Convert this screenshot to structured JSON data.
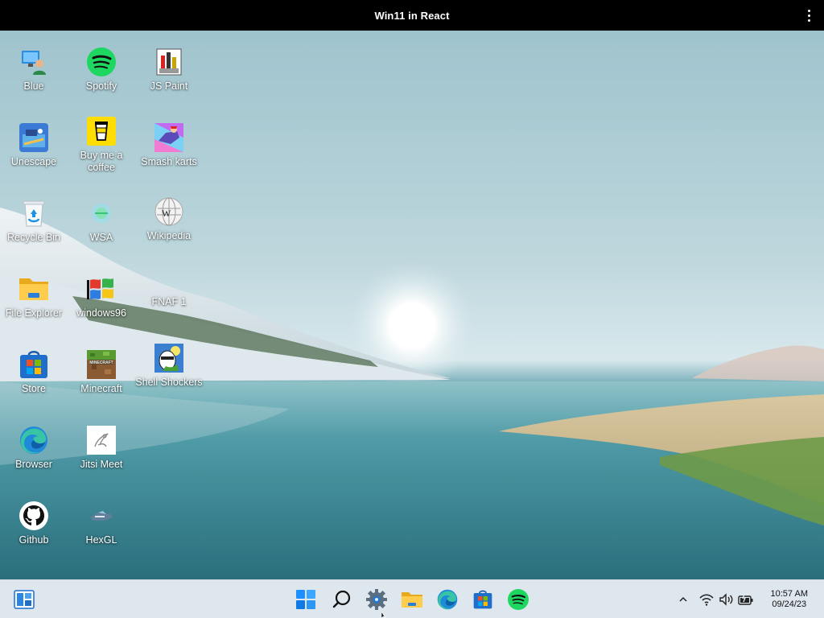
{
  "window": {
    "title": "Win11 in React"
  },
  "desktop_icons": [
    {
      "label": "Blue",
      "icon": "blue-user-icon"
    },
    {
      "label": "Spotify",
      "icon": "spotify-icon"
    },
    {
      "label": "JS Paint",
      "icon": "paint-icon"
    },
    {
      "label": "Unescape",
      "icon": "unescape-icon"
    },
    {
      "label": "Buy me a coffee",
      "icon": "coffee-cup-icon"
    },
    {
      "label": "Smash karts",
      "icon": "smash-karts-icon"
    },
    {
      "label": "Recycle Bin",
      "icon": "recycle-bin-icon"
    },
    {
      "label": "WSA",
      "icon": "wsa-icon"
    },
    {
      "label": "Wikipedia",
      "icon": "wikipedia-icon"
    },
    {
      "label": "File Explorer",
      "icon": "folder-icon"
    },
    {
      "label": "windows96",
      "icon": "windows96-icon"
    },
    {
      "label": "FNAF 1",
      "icon": "fnaf-icon"
    },
    {
      "label": "Store",
      "icon": "store-icon"
    },
    {
      "label": "Minecraft",
      "icon": "minecraft-icon"
    },
    {
      "label": "Shell Shockers",
      "icon": "shell-shockers-icon"
    },
    {
      "label": "Browser",
      "icon": "edge-icon"
    },
    {
      "label": "Jitsi Meet",
      "icon": "jitsi-icon"
    },
    {
      "label": "Github",
      "icon": "github-icon"
    },
    {
      "label": "HexGL",
      "icon": "hexgl-icon"
    }
  ],
  "taskbar": {
    "widgets_icon": "widgets-icon",
    "pinned": [
      "start-icon",
      "search-icon",
      "settings-icon",
      "file-explorer-icon",
      "edge-icon",
      "store-icon",
      "spotify-icon"
    ],
    "tray": [
      "chevron-up-icon",
      "wifi-icon",
      "volume-icon",
      "battery-icon"
    ],
    "clock": {
      "time": "10:57 AM",
      "date": "09/24/23"
    }
  },
  "colors": {
    "taskbar_bg": "#dfe7ee",
    "titlebar_bg": "#000000",
    "accent": "#0067c0"
  }
}
